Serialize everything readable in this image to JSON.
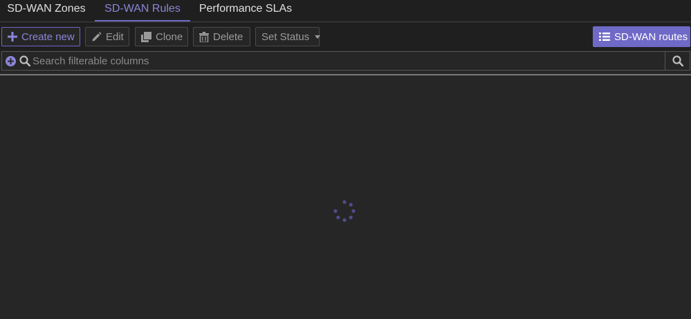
{
  "tabs": [
    {
      "label": "SD-WAN Zones",
      "active": false
    },
    {
      "label": "SD-WAN Rules",
      "active": true
    },
    {
      "label": "Performance SLAs",
      "active": false
    }
  ],
  "toolbar": {
    "create_label": "Create new",
    "edit_label": "Edit",
    "clone_label": "Clone",
    "delete_label": "Delete",
    "status_label": "Set Status",
    "routes_label": "SD-WAN routes"
  },
  "search": {
    "placeholder": "Search filterable columns",
    "value": ""
  },
  "icons": {
    "create": "plus-icon",
    "edit": "pencil-icon",
    "clone": "clone-icon",
    "delete": "trash-icon",
    "routes": "list-icon",
    "filter_add": "plus-circle-icon",
    "search": "search-icon",
    "loading": "spinner-icon"
  },
  "colors": {
    "accent": "#6f69c7",
    "accent_text": "#8b86d8",
    "background": "#262626"
  }
}
